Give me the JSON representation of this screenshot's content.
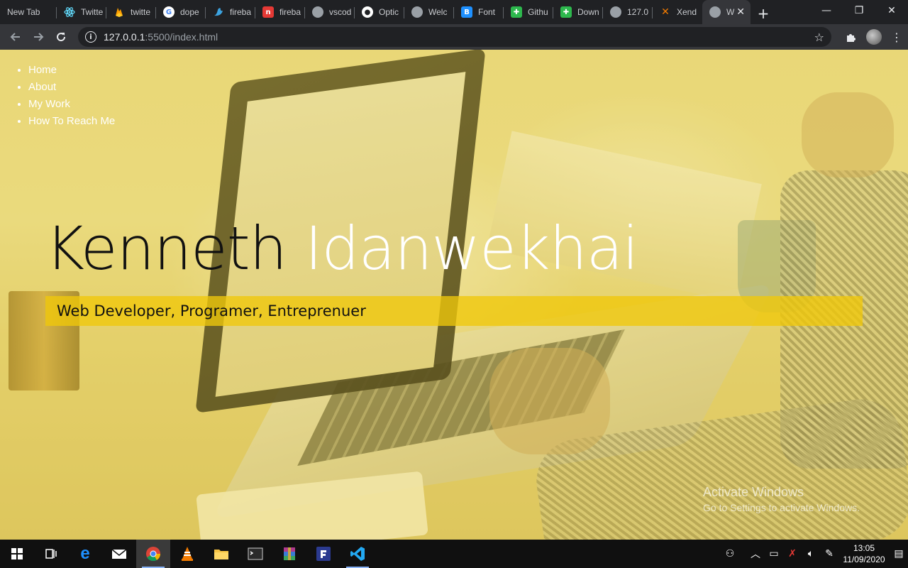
{
  "browser": {
    "tabs": [
      {
        "title": "New Tab",
        "icon": "none",
        "color": ""
      },
      {
        "title": "Twitte",
        "icon": "react-icon",
        "color": "#61dafb"
      },
      {
        "title": "twitte",
        "icon": "firebase-icon",
        "color": "#ffa000"
      },
      {
        "title": "dope",
        "icon": "google-icon",
        "color": "#ffffff"
      },
      {
        "title": "fireba",
        "icon": "bird-icon",
        "color": "#3ca3e0"
      },
      {
        "title": "fireba",
        "icon": "n-icon",
        "color": "#e53935"
      },
      {
        "title": "vscod",
        "icon": "globe-icon",
        "color": "#9aa0a6"
      },
      {
        "title": "Optic",
        "icon": "github-icon",
        "color": "#ffffff"
      },
      {
        "title": "Welc",
        "icon": "globe-icon",
        "color": "#9aa0a6"
      },
      {
        "title": "Font",
        "icon": "b-icon",
        "color": "#1e90ff"
      },
      {
        "title": "Githu",
        "icon": "puzzle-icon",
        "color": "#2db84d"
      },
      {
        "title": "Down",
        "icon": "puzzle-icon",
        "color": "#2db84d"
      },
      {
        "title": "127.0",
        "icon": "globe-icon",
        "color": "#9aa0a6"
      },
      {
        "title": "Xend",
        "icon": "x-icon",
        "color": "#f57c00"
      },
      {
        "title": "W",
        "icon": "globe-icon",
        "color": "#9aa0a6"
      }
    ],
    "url_host": "127.0.0.1",
    "url_rest": ":5500/index.html"
  },
  "nav": {
    "items": [
      "Home",
      "About",
      "My Work",
      "How To Reach Me"
    ]
  },
  "hero": {
    "first_name": "Kenneth",
    "last_name": "Idanwekhai",
    "tagline": "Web Developer, Programer, Entreprenuer"
  },
  "watermark": {
    "line1": "Activate Windows",
    "line2": "Go to Settings to activate Windows."
  },
  "taskbar": {
    "time": "13:05",
    "date": "11/09/2020"
  }
}
